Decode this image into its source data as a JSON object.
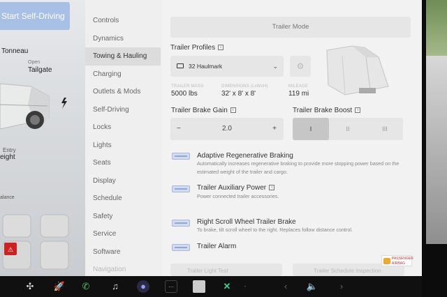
{
  "car_view": {
    "start_button": "Start Self-Driving",
    "labels": {
      "tonneau": "Tonneau",
      "open": "Open",
      "tailgate": "Tailgate",
      "entry": "Entry",
      "height": "eight",
      "balance": "alance"
    },
    "status_icon": "lightning-icon",
    "alert_icon": "airbag-warning-icon"
  },
  "menu": {
    "items": [
      {
        "label": "Controls"
      },
      {
        "label": "Dynamics"
      },
      {
        "label": "Towing & Hauling",
        "active": true
      },
      {
        "label": "Charging"
      },
      {
        "label": "Outlets & Mods"
      },
      {
        "label": "Self-Driving"
      },
      {
        "label": "Locks"
      },
      {
        "label": "Lights"
      },
      {
        "label": "Seats"
      },
      {
        "label": "Display"
      },
      {
        "label": "Schedule"
      },
      {
        "label": "Safety"
      },
      {
        "label": "Service"
      },
      {
        "label": "Software"
      },
      {
        "label": "Navigation"
      }
    ]
  },
  "trailer_mode": {
    "header": "Trailer Mode",
    "profiles_label": "Trailer Profiles",
    "profile_selected": "32 Haulmark",
    "profile_icon": "trailer-icon",
    "settings_icon": "gear-icon",
    "stats": [
      {
        "caption": "TRAILER MASS",
        "value": "5000 lbs"
      },
      {
        "caption": "DIMENSIONS (LxWxH)",
        "value": "32' x 8' x 8'"
      },
      {
        "caption": "MILEAGE",
        "value": "119 mi"
      }
    ],
    "brake_gain": {
      "label": "Trailer Brake Gain",
      "value": "2.0",
      "minus": "−",
      "plus": "+"
    },
    "brake_boost": {
      "label": "Trailer Brake Boost",
      "options": [
        "I",
        "II",
        "III"
      ],
      "selected": "I"
    },
    "options": [
      {
        "title": "Adaptive Regenerative Braking",
        "desc": "Automatically increases regenerative braking to provide more stopping power based on the estimated weight of the trailer and cargo.",
        "enabled": true
      },
      {
        "title": "Trailer Auxiliary Power",
        "desc": "Power connected trailer accessories.",
        "enabled": true
      },
      {
        "title": "Right Scroll Wheel Trailer Brake",
        "desc": "To brake, tilt scroll wheel to the right. Replaces follow distance control.",
        "enabled": true
      },
      {
        "title": "Trailer Alarm",
        "desc": "",
        "enabled": true
      }
    ],
    "bottom_left": "Trailer Light Test",
    "bottom_right": "Trailer Schedule Inspection"
  },
  "badge": {
    "line1": "PASSENGER",
    "line2": "AIRBAG"
  },
  "dock": {
    "icons": [
      "fan-icon",
      "rocket-icon",
      "phone-icon",
      "music-icon",
      "camera-icon",
      "more-icon",
      "photo-app-icon",
      "xmode-icon",
      "dot-icon",
      "chevron-left-icon",
      "volume-icon",
      "chevron-right-icon"
    ]
  },
  "colors": {
    "accent": "#8fa6d8",
    "start_button": "#a9c0e6"
  }
}
